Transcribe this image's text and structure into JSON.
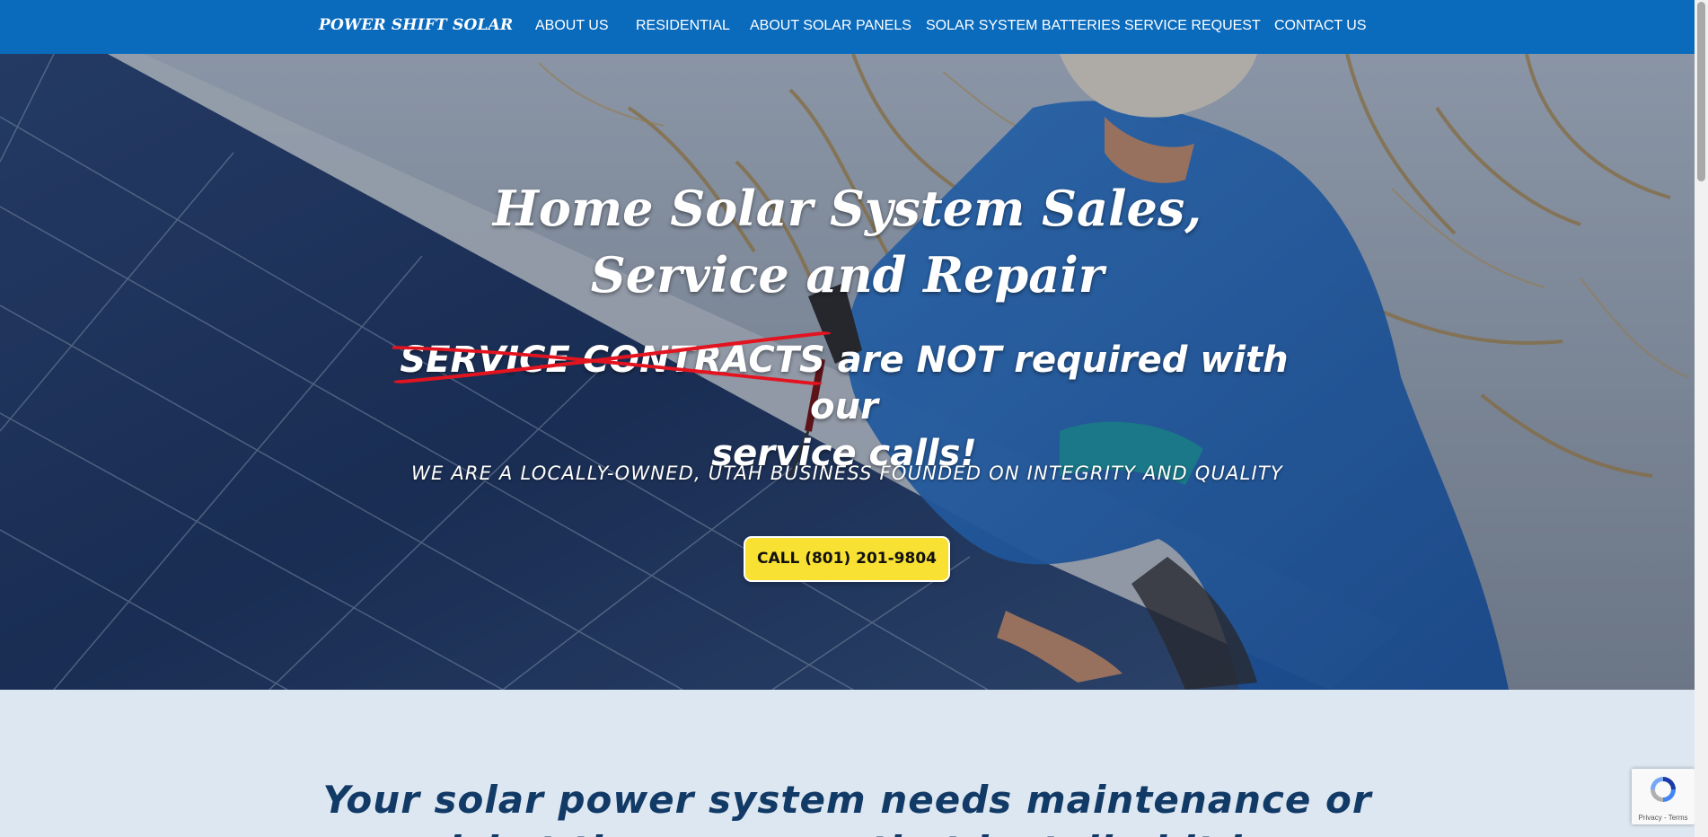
{
  "brand": "POWER SHIFT SOLAR",
  "nav": {
    "items": [
      {
        "label": "ABOUT US"
      },
      {
        "label": "RESIDENTIAL"
      },
      {
        "label": "ABOUT SOLAR PANELS"
      },
      {
        "label": "SOLAR SYSTEM BATTERIES"
      },
      {
        "label": "SERVICE REQUEST"
      },
      {
        "label": "CONTACT US"
      }
    ]
  },
  "hero": {
    "title_line1": "Home Solar System Sales,",
    "title_line2": "Service and Repair",
    "struck_text": "SERVICE CONTRACTS",
    "sub_after_struck": " are NOT required with our",
    "sub_line2": "service calls!",
    "tagline": "WE ARE A LOCALLY-OWNED, UTAH BUSINESS FOUNDED ON INTEGRITY AND QUALITY",
    "cta_label": "CALL (801) 201-9804"
  },
  "section": {
    "heading_line1": "Your solar power system needs maintenance or",
    "heading_line2": "riskat the company that installed it is"
  },
  "recaptcha": {
    "terms": "Privacy - Terms"
  },
  "colors": {
    "nav_bg": "#0a6bbd",
    "cta_bg": "#f8e132",
    "strike": "#e3141f",
    "heading": "#123a66",
    "lower_bg": "#dde7f1"
  }
}
